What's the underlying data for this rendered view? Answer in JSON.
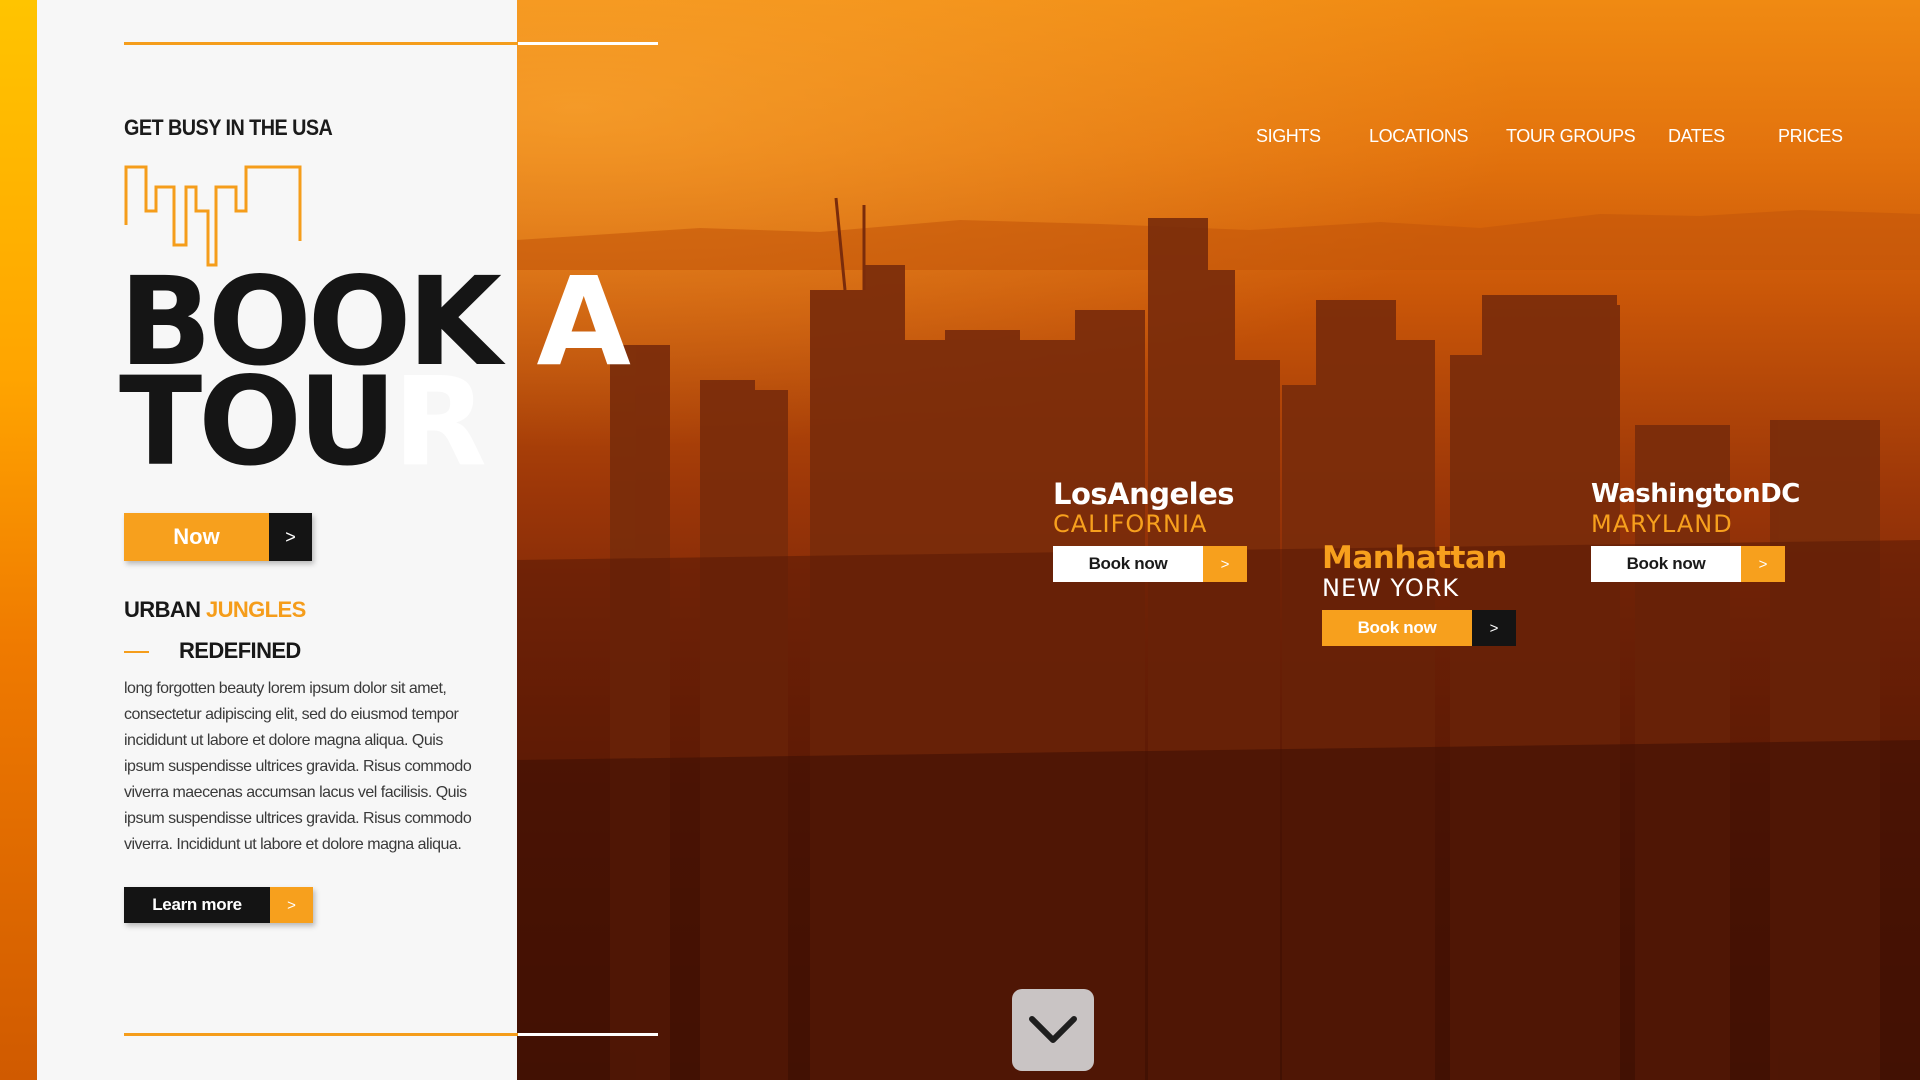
{
  "theme": {
    "accent": "#f7a01d",
    "dark": "#141414",
    "panel": "#f7f7f7"
  },
  "nav": [
    {
      "label": "SIGHTS"
    },
    {
      "label": "LOCATIONS"
    },
    {
      "label": "TOUR GROUPS"
    },
    {
      "label": "DATES"
    },
    {
      "label": "PRICES"
    }
  ],
  "hero": {
    "eyebrow": "GET BUSY IN THE USA",
    "headline_line1_dark": "BOOK ",
    "headline_line1_light": "A",
    "headline_line2_dark": "TOU",
    "headline_line2_light": "R",
    "cta_label": "Now",
    "cta_arrow": ">"
  },
  "section": {
    "title_dark": "URBAN ",
    "title_accent": "JUNGLES",
    "subtitle": "REDEFINED",
    "body": "long forgotten beauty lorem ipsum dolor sit amet, consectetur adipiscing elit, sed do eiusmod tempor incididunt ut labore et dolore magna aliqua. Quis ipsum suspendisse ultrices gravida. Risus commodo viverra maecenas accumsan lacus vel facilisis. Quis ipsum suspendisse ultrices gravida. Risus commodo viverra. Incididunt ut labore et dolore magna aliqua.",
    "learn_label": "Learn more",
    "learn_arrow": ">"
  },
  "tours": [
    {
      "city": "LosAngeles",
      "state": "CALIFORNIA",
      "button": "Book now",
      "arrow": ">"
    },
    {
      "city": "Manhattan",
      "state": "NEW YORK",
      "button": "Book now",
      "arrow": ">"
    },
    {
      "city": "WashingtonDC",
      "state": "MARYLAND",
      "button": "Book now",
      "arrow": ">"
    }
  ],
  "icons": {
    "scroll": "chevron-down-icon",
    "logo": "city-skyline-logo-icon"
  }
}
